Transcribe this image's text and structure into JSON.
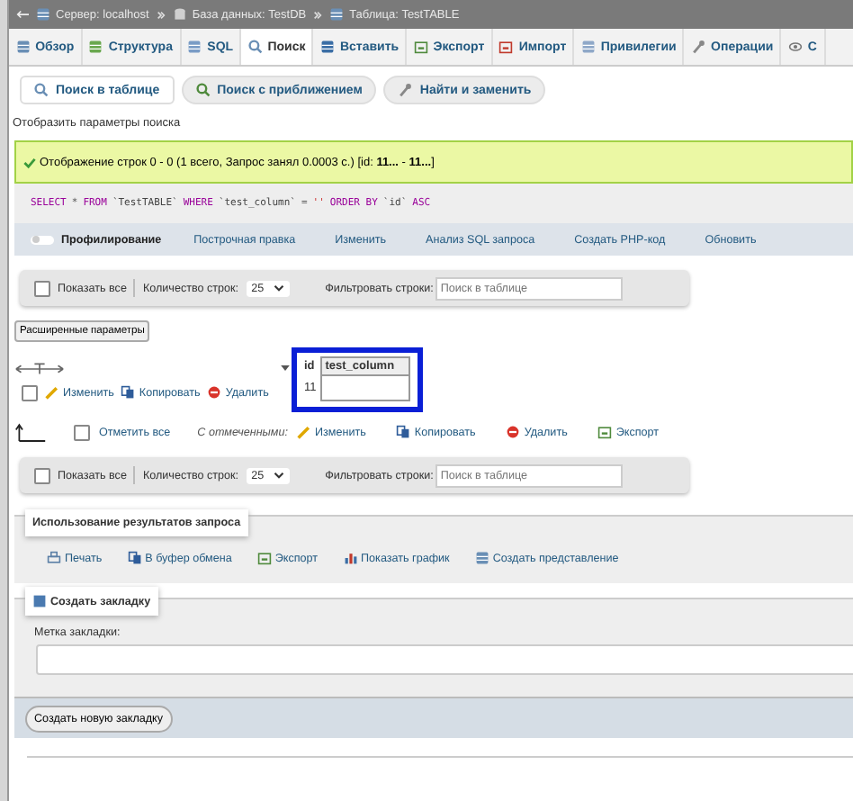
{
  "breadcrumb": [
    {
      "label": "Сервер: localhost"
    },
    {
      "label": "База данных: TestDB"
    },
    {
      "label": "Таблица: TestTABLE"
    }
  ],
  "tabs": [
    {
      "label": "Обзор",
      "selected": false
    },
    {
      "label": "Структура",
      "selected": false
    },
    {
      "label": "SQL",
      "selected": false
    },
    {
      "label": "Поиск",
      "selected": true
    },
    {
      "label": "Вставить",
      "selected": false
    },
    {
      "label": "Экспорт",
      "selected": false
    },
    {
      "label": "Импорт",
      "selected": false
    },
    {
      "label": "Привилегии",
      "selected": false
    },
    {
      "label": "Операции",
      "selected": false
    },
    {
      "label": "С",
      "selected": false
    }
  ],
  "subtabs": [
    {
      "label": "Поиск в таблице",
      "selected": true
    },
    {
      "label": "Поиск с приближением",
      "selected": false
    },
    {
      "label": "Найти и заменить",
      "selected": false
    }
  ],
  "search_toggle": "Отобразить параметры поиска",
  "message": "Отображение строк 0 - 0 (1 всего, Запрос занял 0.0003 с.) [id: **11...** - **11...**]",
  "sql": [
    {
      "text": "SELECT",
      "kind": "keyword"
    },
    {
      "text": "*",
      "kind": "operator"
    },
    {
      "text": "FROM",
      "kind": "keyword"
    },
    {
      "text": "`TestTABLE`",
      "kind": "identifier"
    },
    {
      "text": "WHERE",
      "kind": "keyword"
    },
    {
      "text": "`test_column`",
      "kind": "identifier"
    },
    {
      "text": "=",
      "kind": "operator"
    },
    {
      "text": "''",
      "kind": "string"
    },
    {
      "text": "ORDER BY",
      "kind": "keyword"
    },
    {
      "text": "`id`",
      "kind": "identifier"
    },
    {
      "text": "ASC",
      "kind": "keyword"
    }
  ],
  "profiling": {
    "label": "Профилирование",
    "on": false
  },
  "query_actions": [
    "Построчная правка",
    "Изменить",
    "Анализ SQL запроса",
    "Создать PHP-код",
    "Обновить"
  ],
  "navigation_top": {
    "show_all": {
      "label": "Показать все",
      "checked": false
    },
    "rows_label": "Количество строк:",
    "rows_value": "25",
    "filter_label": "Фильтровать строки:",
    "filter_placeholder": "Поиск в таблице"
  },
  "advanced_button": "Расширенные параметры",
  "results": {
    "columns": [
      "id",
      "test_column"
    ],
    "rows": [
      {
        "checked": false,
        "actions": [
          "Изменить",
          "Копировать",
          "Удалить"
        ],
        "id": "11"
      }
    ]
  },
  "bulk": {
    "check_all": {
      "label": "Отметить все",
      "checked": false
    },
    "with_selected": "С отмеченными:",
    "actions": [
      "Изменить",
      "Копировать",
      "Удалить",
      "Экспорт"
    ]
  },
  "navigation_bottom": {
    "show_all": {
      "label": "Показать все",
      "checked": false
    },
    "rows_label": "Количество строк:",
    "rows_value": "25",
    "filter_label": "Фильтровать строки:",
    "filter_placeholder": "Поиск в таблице"
  },
  "query_results": {
    "legend": "Использование результатов запроса",
    "actions": [
      "Печать",
      "В буфер обмена",
      "Экспорт",
      "Показать график",
      "Создать представление"
    ]
  },
  "bookmark": {
    "legend": "Создать закладку",
    "label": "Метка закладки:",
    "button": "Создать новую закладку"
  }
}
